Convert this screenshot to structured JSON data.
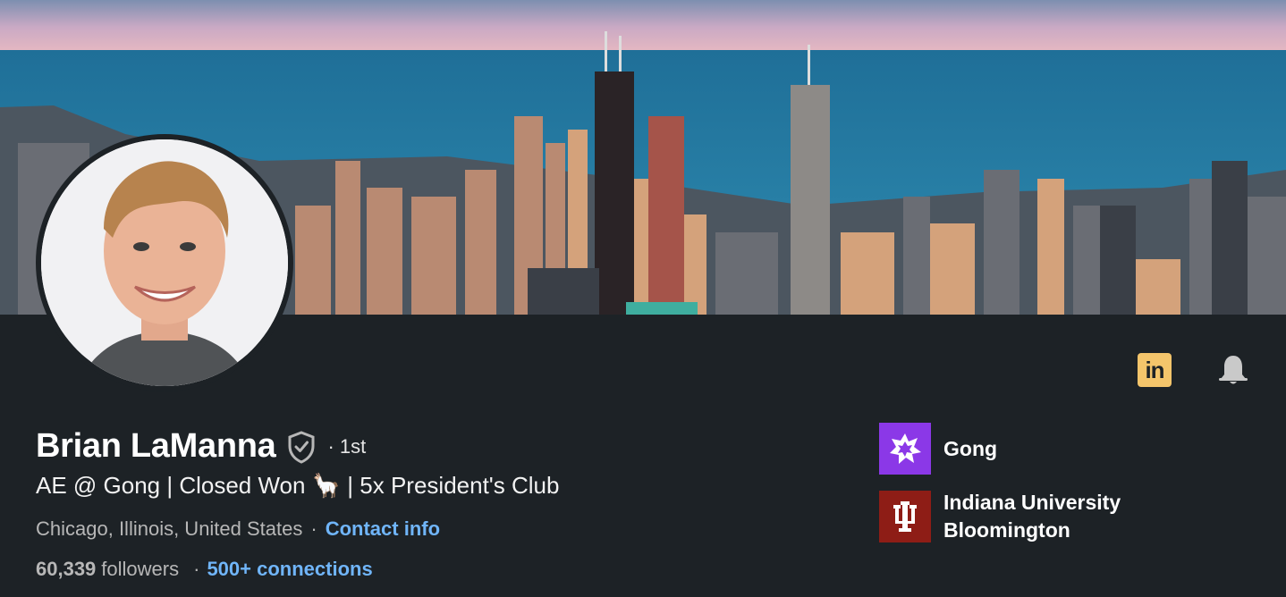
{
  "profile": {
    "name": "Brian LaManna",
    "verified_icon": "shield-check-icon",
    "degree": "· 1st",
    "headline": "AE @ Gong | Closed Won 🦙 | 5x President's Club",
    "location": "Chicago, Illinois, United States",
    "separator": "·",
    "contact_info_label": "Contact info",
    "followers_count": "60,339",
    "followers_label": "followers",
    "connections_label": "500+ connections"
  },
  "actions": {
    "linkedin_badge": "in",
    "bell_icon": "bell-icon"
  },
  "organizations": [
    {
      "name": "Gong",
      "logo": "gong-logo-icon",
      "color": "#8b38e7"
    },
    {
      "name_line1": "Indiana University",
      "name_line2": "Bloomington",
      "logo": "iu-trident-icon",
      "color": "#8e1d16"
    }
  ],
  "colors": {
    "background": "#1d2226",
    "link": "#70b5f9",
    "muted_text": "#b7b7b7",
    "linkedin_badge": "#f4c56b"
  }
}
